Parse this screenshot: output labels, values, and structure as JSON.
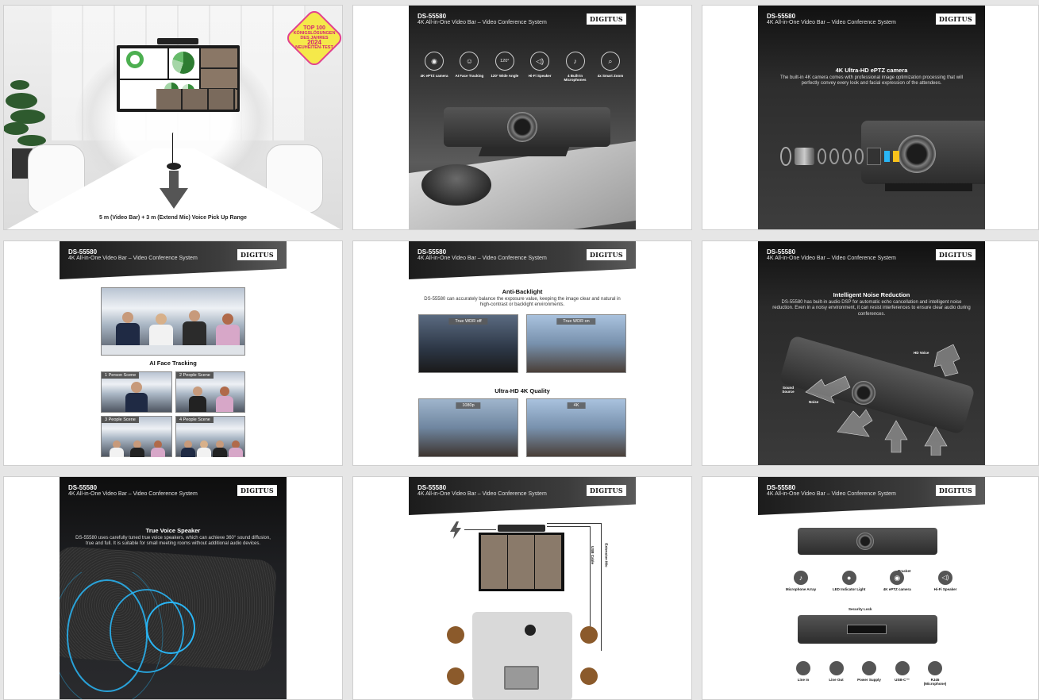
{
  "product": {
    "model": "DS-55580",
    "subtitle": "4K All-in-One Video Bar – Video Conference System",
    "brand": "DIGITUS"
  },
  "tile1": {
    "badge": [
      "TOP 100",
      "KÖNIGSLÖSUNGEN",
      "DES JAHRES",
      "2024",
      "NEUHEITEN-TEST"
    ],
    "range_text": "5 m (Video Bar) + 3 m (Extend Mic) Voice Pick Up Range"
  },
  "tile2": {
    "features": [
      {
        "icon": "camera-icon",
        "label": "4K ePTZ camera"
      },
      {
        "icon": "face-tracking-icon",
        "label": "AI Face Tracking"
      },
      {
        "icon": "wide-angle-icon",
        "label": "120° Wide Angle",
        "glyph": "120°"
      },
      {
        "icon": "speaker-icon",
        "label": "Hi-Fi Speaker"
      },
      {
        "icon": "microphone-icon",
        "label": "4 Built-in Microphones"
      },
      {
        "icon": "zoom-icon",
        "label": "4x Smart Zoom"
      }
    ]
  },
  "tile3": {
    "title": "4K Ultra-HD ePTZ camera",
    "desc": "The built-in 4K camera comes with professional image optimization processing that will perfectly convey every look and facial expression of the attendees."
  },
  "tile4": {
    "title": "AI Face Tracking",
    "scenes": [
      "1 Person Scene",
      "2 People Scene",
      "3 People Scene",
      "4 People Scene"
    ]
  },
  "tile5": {
    "title1": "Anti-Backlight",
    "desc1": "DS-55580 can accurately balance the exposure value, keeping the image clear and natural in high-contrast or backlight environments.",
    "wdr_off": "True WDR off",
    "wdr_on": "True WDR on",
    "title2": "Ultra-HD 4K Quality",
    "res_low": "1080p",
    "res_high": "4K"
  },
  "tile6": {
    "title": "Intelligent Noise Reduction",
    "desc": "DS-55580 has built-in audio DSP for automatic echo cancellation and intelligent noise reduction. Even in a noisy environment, it can resist interferences to ensure clear audio during conferences.",
    "label_voice": "HD Voice",
    "label_source": "Sound Source",
    "label_noise": "Noise"
  },
  "tile7": {
    "title": "True Voice Speaker",
    "desc": "DS-55580 uses carefully tuned true voice speakers, which can achieve 360° sound diffusion, true and full. It is suitable for small meeting rooms without additional audio devices."
  },
  "tile8": {
    "label_mic": "Extension Mic",
    "label_usb": "USB Cable"
  },
  "tile9": {
    "bracket": "Bracket",
    "front_labels": [
      "Microphone Array",
      "LED Indicator Light",
      "4K ePTZ camera",
      "Hi-Fi Speaker"
    ],
    "security_lock": "Security Lock",
    "back_labels": [
      "Line In",
      "Line Out",
      "Power Supply",
      "USB-C™",
      "RJ45 (Microphone)"
    ]
  },
  "colors": {
    "badge_yellow": "#f5e94a",
    "badge_pink": "#e2428d",
    "speaker_glow": "#29b6f6",
    "room_table": "#d9d9d9"
  }
}
